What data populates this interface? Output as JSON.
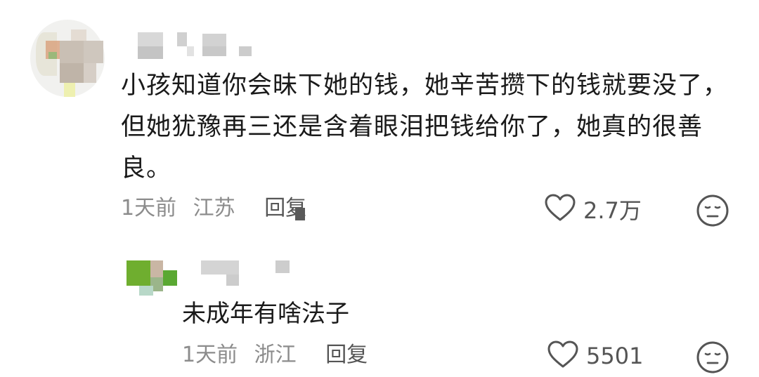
{
  "comments": [
    {
      "text": "小孩知道你会昧下她的钱，她辛苦攒下的钱就要没了，但她犹豫再三还是含着眼泪把钱给你了，她真的很善良。",
      "time": "1天前",
      "region": "江苏",
      "reply_label": "回复",
      "likes": "2.7万"
    },
    {
      "text": "未成年有啥法子",
      "time": "1天前",
      "region": "浙江",
      "reply_label": "回复",
      "likes": "5501"
    }
  ],
  "icons": {
    "like": "heart-outline-icon",
    "reaction": "neutral-face-icon"
  },
  "colors": {
    "text": "#1a1a1a",
    "meta": "#8c8c8c",
    "icon": "#555555"
  }
}
